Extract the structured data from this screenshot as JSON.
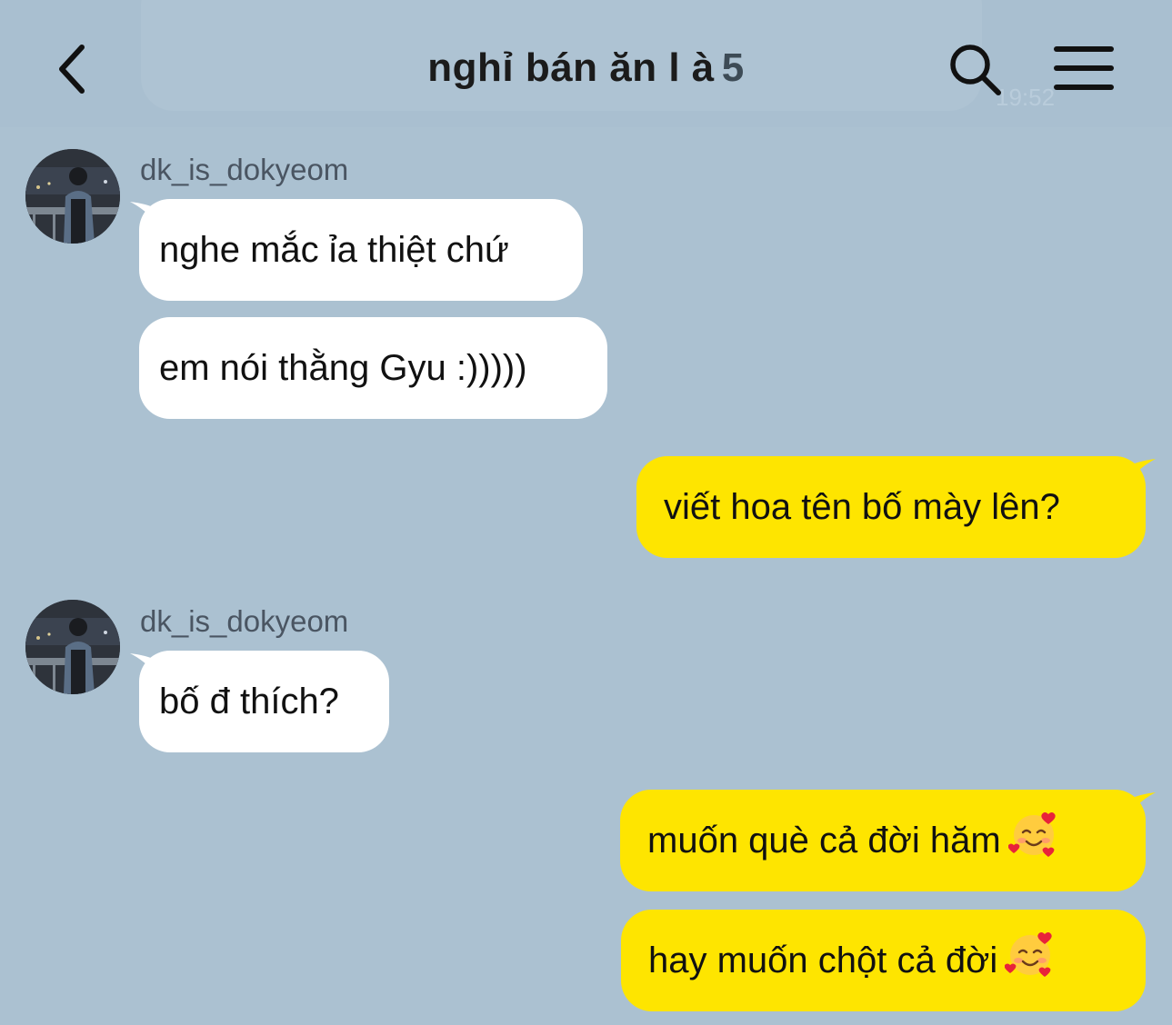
{
  "header": {
    "title": "nghỉ bán ăn l à",
    "member_count": "5",
    "ghost_time": "19:52"
  },
  "icons": {
    "back": "chevron-left-icon",
    "search": "search-icon",
    "menu": "hamburger-menu-icon",
    "emoji": "smiling-face-with-hearts"
  },
  "colors": {
    "background": "#abc1d1",
    "incoming_bubble": "#ffffff",
    "outgoing_bubble": "#fee500"
  },
  "messages": [
    {
      "sender": "dk_is_dokyeom",
      "text": "nghe mắc ỉa thiệt chứ"
    },
    {
      "text": "em nói thằng Gyu :)))))"
    },
    {
      "text": "viết hoa tên bố mày lên?"
    },
    {
      "sender": "dk_is_dokyeom",
      "text": "bố đ thích?"
    },
    {
      "text": "muốn què cả đời hăm"
    },
    {
      "text": "hay muốn chột cả đời"
    }
  ]
}
